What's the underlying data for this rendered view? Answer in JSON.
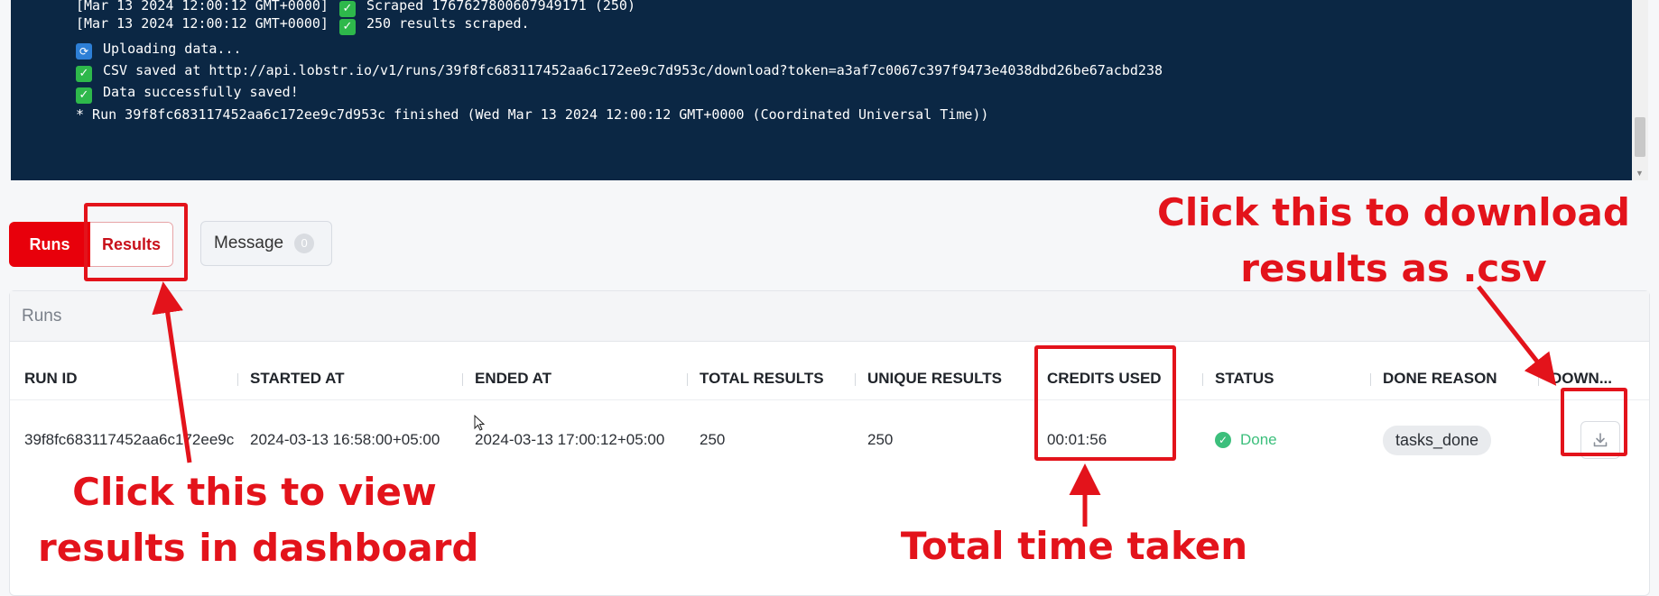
{
  "console": {
    "lines": [
      {
        "prefix": "[Mar 13 2024 12:00:12 GMT+0000]",
        "icon": "check-icon",
        "text": "Scraped 1767627800607949171 (250)"
      },
      {
        "prefix": "[Mar 13 2024 12:00:12 GMT+0000]",
        "icon": "check-icon",
        "text": "250 results scraped."
      },
      {
        "icon": "upload-icon",
        "text": "Uploading data..."
      },
      {
        "icon": "check-icon",
        "text": "CSV saved at http://api.lobstr.io/v1/runs/39f8fc683117452aa6c172ee9c7d953c/download?token=a3af7c0067c397f9473e4038dbd26be67acbd238"
      },
      {
        "icon": "check-icon",
        "text": "Data successfully saved!"
      },
      {
        "text": "* Run 39f8fc683117452aa6c172ee9c7d953c finished (Wed Mar 13 2024 12:00:12 GMT+0000 (Coordinated Universal Time))"
      }
    ]
  },
  "tabs": {
    "runs": "Runs",
    "results": "Results",
    "message": "Message",
    "message_count": "0"
  },
  "runs_panel": {
    "title": "Runs",
    "columns": [
      "RUN ID",
      "STARTED AT",
      "ENDED AT",
      "TOTAL RESULTS",
      "UNIQUE RESULTS",
      "CREDITS USED",
      "STATUS",
      "DONE REASON",
      "DOWN..."
    ],
    "rows": [
      {
        "run_id": "39f8fc683117452aa6c172ee9c",
        "started_at": "2024-03-13 16:58:00+05:00",
        "ended_at": "2024-03-13 17:00:12+05:00",
        "total_results": "250",
        "unique_results": "250",
        "credits_used": "00:01:56",
        "status": "Done",
        "done_reason": "tasks_done"
      }
    ]
  },
  "annotations": {
    "download": [
      "Click this to download",
      "results as .csv"
    ],
    "results": [
      "Click this to view",
      "results in dashboard"
    ],
    "time": "Total time taken"
  },
  "colors": {
    "accent": "#e8000b",
    "annotation": "#e3131b",
    "console_bg": "#0b2744",
    "done_green": "#3cbf7c"
  }
}
